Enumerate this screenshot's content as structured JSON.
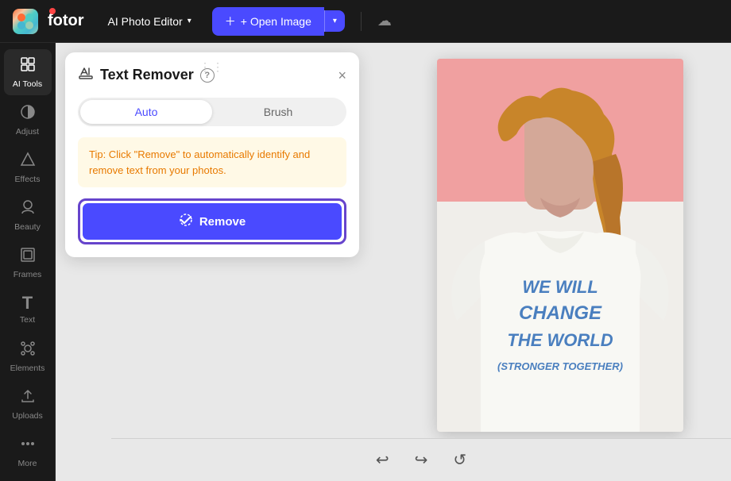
{
  "topbar": {
    "logo_text": "fotor",
    "editor_label": "AI Photo Editor",
    "open_image_label": "+ Open Image",
    "chevron": "▾"
  },
  "sidebar": {
    "items": [
      {
        "id": "ai-tools",
        "label": "AI Tools",
        "icon": "⚡",
        "active": true
      },
      {
        "id": "adjust",
        "label": "Adjust",
        "icon": "◑"
      },
      {
        "id": "effects",
        "label": "Effects",
        "icon": "△"
      },
      {
        "id": "beauty",
        "label": "Beauty",
        "icon": "✦"
      },
      {
        "id": "frames",
        "label": "Frames",
        "icon": "▣"
      },
      {
        "id": "text",
        "label": "Text",
        "icon": "T"
      },
      {
        "id": "elements",
        "label": "Elements",
        "icon": "❁"
      },
      {
        "id": "uploads",
        "label": "Uploads",
        "icon": "↑"
      },
      {
        "id": "more",
        "label": "More",
        "icon": "•••"
      }
    ]
  },
  "panel": {
    "title": "Text Remover",
    "help_label": "?",
    "close_label": "×",
    "drag_dots": "⋮⋮",
    "mode_auto": "Auto",
    "mode_brush": "Brush",
    "tip_text": "Tip: Click \"Remove\" to automatically identify and remove text from your photos.",
    "remove_label": "Remove"
  },
  "photo": {
    "text_lines": [
      "WE WILL",
      "CHANGE",
      "THE WORLD",
      "(STRONGER TOGETHER)"
    ]
  },
  "bottom": {
    "undo_icon": "↩",
    "redo_icon": "↪",
    "reset_icon": "↺"
  }
}
